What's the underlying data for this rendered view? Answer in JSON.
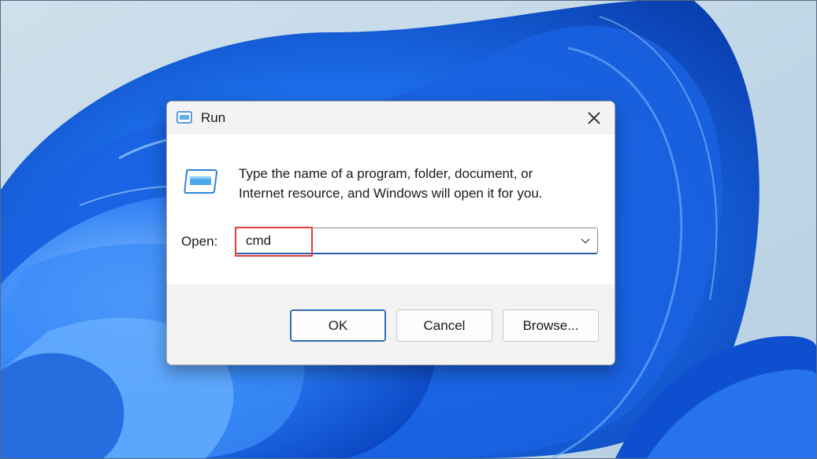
{
  "window": {
    "title": "Run",
    "close_icon": "close-icon",
    "app_icon": "run-icon"
  },
  "content": {
    "description_line1": "Type the name of a program, folder, document, or",
    "description_line2": "Internet resource, and Windows will open it for you.",
    "open_label": "Open:",
    "open_value": "cmd",
    "dropdown_icon": "chevron-down-icon"
  },
  "buttons": {
    "ok_label": "OK",
    "cancel_label": "Cancel",
    "browse_label": "Browse..."
  },
  "colors": {
    "accent": "#2b6cb5",
    "highlight": "#e0403a",
    "wallpaper_blue": "#1a62e0",
    "wallpaper_sky": "#c5dbea"
  }
}
